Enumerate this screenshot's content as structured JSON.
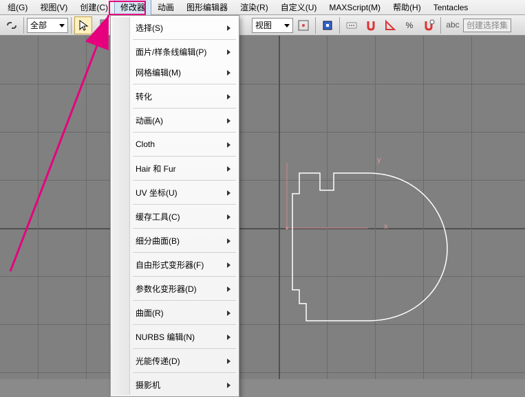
{
  "menubar": {
    "items": [
      {
        "label": "组(G)"
      },
      {
        "label": "视图(V)"
      },
      {
        "label": "创建(C)"
      },
      {
        "label": "修改器"
      },
      {
        "label": "动画"
      },
      {
        "label": "图形编辑器"
      },
      {
        "label": "渲染(R)"
      },
      {
        "label": "自定义(U)"
      },
      {
        "label": "MAXScript(M)"
      },
      {
        "label": "帮助(H)"
      },
      {
        "label": "Tentacles"
      }
    ],
    "active_index": 3
  },
  "toolbar": {
    "dropdown1": "全部",
    "dropdown2": "视图",
    "named_sel": "创建选择集"
  },
  "submenu": {
    "items": [
      {
        "label": "选择(S)",
        "arrow": true
      },
      {
        "sep": true
      },
      {
        "label": "面片/样条线编辑(P)",
        "arrow": true
      },
      {
        "label": "网格编辑(M)",
        "arrow": true
      },
      {
        "sep": true
      },
      {
        "label": "转化",
        "arrow": true
      },
      {
        "sep": true
      },
      {
        "label": "动画(A)",
        "arrow": true
      },
      {
        "sep": true
      },
      {
        "label": "Cloth",
        "arrow": true
      },
      {
        "sep": true
      },
      {
        "label": "Hair 和 Fur",
        "arrow": true
      },
      {
        "sep": true
      },
      {
        "label": "UV 坐标(U)",
        "arrow": true
      },
      {
        "sep": true
      },
      {
        "label": "缓存工具(C)",
        "arrow": true
      },
      {
        "sep": true
      },
      {
        "label": "细分曲面(B)",
        "arrow": true
      },
      {
        "sep": true
      },
      {
        "label": "自由形式变形器(F)",
        "arrow": true
      },
      {
        "sep": true
      },
      {
        "label": "参数化变形器(D)",
        "arrow": true
      },
      {
        "sep": true
      },
      {
        "label": "曲面(R)",
        "arrow": true
      },
      {
        "sep": true
      },
      {
        "label": "NURBS 编辑(N)",
        "arrow": true
      },
      {
        "sep": true
      },
      {
        "label": "光能传递(D)",
        "arrow": true
      },
      {
        "sep": true
      },
      {
        "label": "摄影机",
        "arrow": true
      }
    ]
  },
  "viewport": {
    "axis_y": "y",
    "axis_x": "x"
  }
}
